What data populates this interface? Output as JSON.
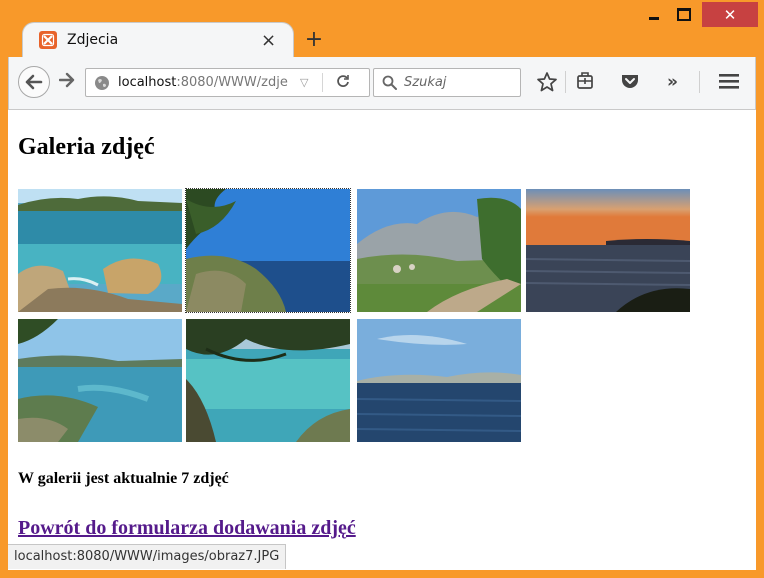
{
  "browser": {
    "tab_title": "Zdjecia",
    "tab_close": "×",
    "new_tab": "+",
    "url_host": "localhost",
    "url_rest": ":8080/WWW/zdje",
    "search_placeholder": "Szukaj",
    "status_url": "localhost:8080/WWW/images/obraz7.JPG"
  },
  "page": {
    "heading": "Galeria zdjęć",
    "count_text": "W galerii jest aktualnie 7 zdjęć",
    "back_link": "Powrót do formularza dodawania zdjęć"
  },
  "gallery": [
    {
      "name": "photo-coast-rocks",
      "focused": false
    },
    {
      "name": "photo-pine-sea",
      "focused": true
    },
    {
      "name": "photo-mountain-path",
      "focused": false
    },
    {
      "name": "photo-sunset-sea",
      "focused": false
    },
    {
      "name": "photo-bay-hills",
      "focused": false
    },
    {
      "name": "photo-pine-lagoon",
      "focused": false
    },
    {
      "name": "photo-open-sea",
      "focused": false
    }
  ],
  "colors": {
    "window_frame": "#F8992A",
    "close_button": "#C74141",
    "visited_link": "#551A8B"
  }
}
